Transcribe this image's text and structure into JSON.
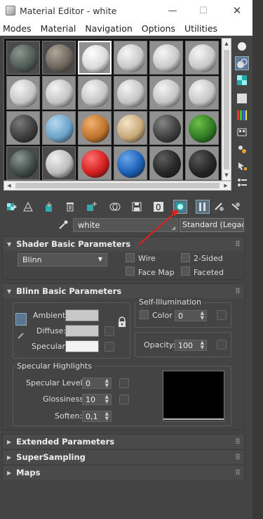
{
  "window": {
    "title": "Material Editor - white"
  },
  "menu": {
    "items": [
      "Modes",
      "Material",
      "Navigation",
      "Options",
      "Utilities"
    ]
  },
  "slots": [
    {
      "color": "#4f5a55",
      "hi": "#8a9690"
    },
    {
      "color": "#6e665c",
      "hi": "#b0a598"
    },
    {
      "color": "#d8d8d8",
      "hi": "#ffffff",
      "selected": true
    },
    {
      "color": "#c8c8c8",
      "hi": "#f6f6f6"
    },
    {
      "color": "#c8c8c8",
      "hi": "#f6f6f6"
    },
    {
      "color": "#c8c8c8",
      "hi": "#f6f6f6"
    },
    {
      "color": "#c4c4c4",
      "hi": "#f4f4f4"
    },
    {
      "color": "#c4c4c4",
      "hi": "#f4f4f4"
    },
    {
      "color": "#c4c4c4",
      "hi": "#f4f4f4"
    },
    {
      "color": "#c4c4c4",
      "hi": "#f4f4f4"
    },
    {
      "color": "#c4c4c4",
      "hi": "#f4f4f4"
    },
    {
      "color": "#c4c4c4",
      "hi": "#f4f4f4"
    },
    {
      "color": "#3c3c3c",
      "hi": "#7a7a7a"
    },
    {
      "color": "#6aa2c8",
      "hi": "#b8d8ee"
    },
    {
      "color": "#c0732c",
      "hi": "#f0b070"
    },
    {
      "color": "#c8a878",
      "hi": "#f4e4c8"
    },
    {
      "color": "#3e3e3e",
      "hi": "#858585"
    },
    {
      "color": "#2f7a24",
      "hi": "#6cc04a"
    },
    {
      "color": "#3e4a46",
      "hi": "#8a9892"
    },
    {
      "color": "#bdbdbd",
      "hi": "#f0f0f0"
    },
    {
      "color": "#d41e1e",
      "hi": "#ff7070"
    },
    {
      "color": "#1a5fb4",
      "hi": "#6aa6ee"
    },
    {
      "color": "#262626",
      "hi": "#5e5e5e"
    },
    {
      "color": "#252525",
      "hi": "#585858"
    }
  ],
  "material": {
    "name": "white",
    "type_button": "Standard (Legacy)"
  },
  "shader": {
    "header": "Shader Basic Parameters",
    "shader_type": "Blinn",
    "wire": "Wire",
    "two_sided": "2-Sided",
    "face_map": "Face Map",
    "faceted": "Faceted"
  },
  "blinn": {
    "header": "Blinn Basic Parameters",
    "ambient": "Ambient:",
    "diffuse": "Diffuse:",
    "specular": "Specular:",
    "ambient_color": "#c8c8c8",
    "diffuse_color": "#c8c8c8",
    "specular_color": "#f2f2f2",
    "self_illum_title": "Self-Illumination",
    "color_label": "Color",
    "color_value": "0",
    "opacity_label": "Opacity:",
    "opacity_value": "100",
    "spec_title": "Specular Highlights",
    "spec_level_label": "Specular Level:",
    "spec_level_value": "0",
    "glossiness_label": "Glossiness:",
    "glossiness_value": "10",
    "soften_label": "Soften:",
    "soften_value": "0,1"
  },
  "collapsed": [
    "Extended Parameters",
    "SuperSampling",
    "Maps"
  ]
}
